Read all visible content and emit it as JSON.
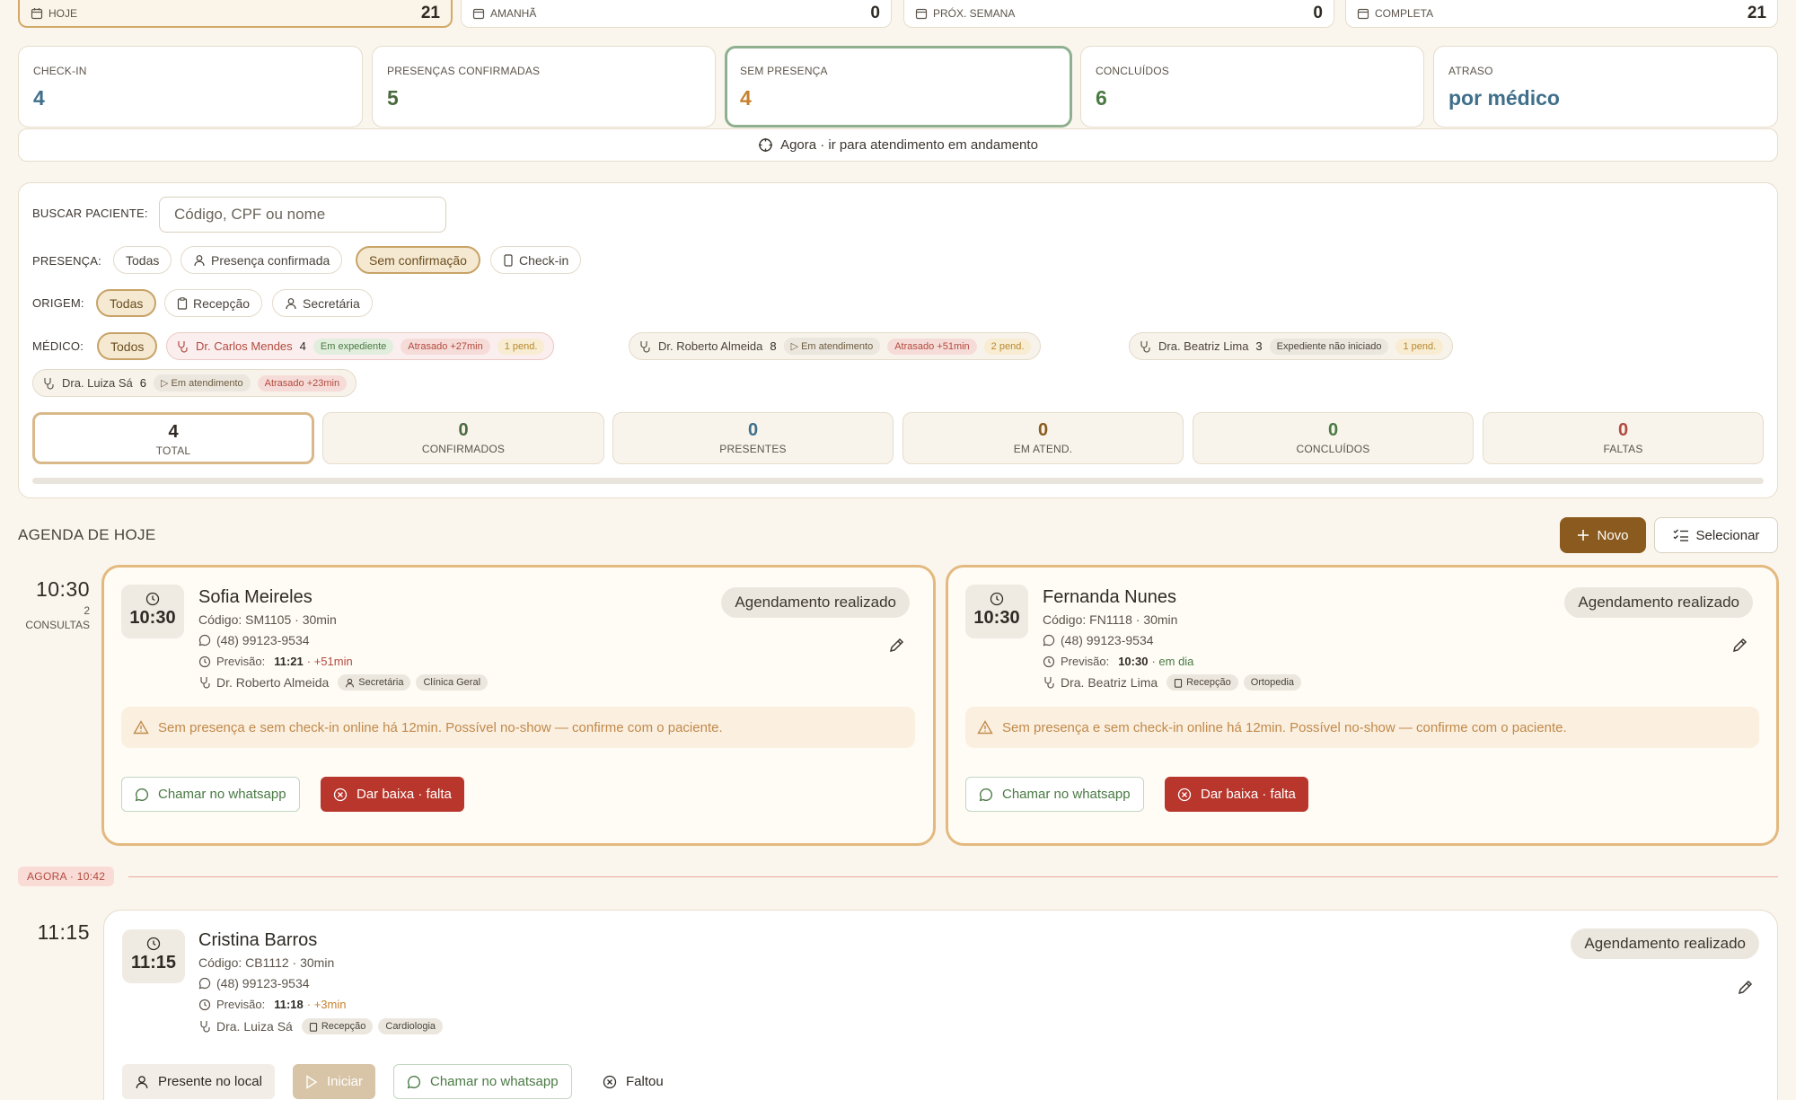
{
  "date_tabs": [
    {
      "label": "HOJE",
      "count": "21"
    },
    {
      "label": "AMANHÃ",
      "count": "0"
    },
    {
      "label": "PRÓX. SEMANA",
      "count": "0"
    },
    {
      "label": "COMPLETA",
      "count": "21"
    }
  ],
  "stats": [
    {
      "label": "CHECK-IN",
      "value": "4"
    },
    {
      "label": "PRESENÇAS CONFIRMADAS",
      "value": "5"
    },
    {
      "label": "SEM PRESENÇA",
      "value": "4"
    },
    {
      "label": "CONCLUÍDOS",
      "value": "6"
    },
    {
      "label": "ATRASO",
      "value": "por médico"
    }
  ],
  "now_link": "Agora · ir para atendimento em andamento",
  "filters": {
    "search_label": "BUSCAR PACIENTE:",
    "search_placeholder": "Código, CPF ou nome",
    "presence_label": "PRESENÇA:",
    "presence": [
      "Todas",
      "Presença confirmada",
      "Sem confirmação",
      "Check-in"
    ],
    "origin_label": "ORIGEM:",
    "origin": [
      "Todas",
      "Recepção",
      "Secretária"
    ],
    "doctor_label": "MÉDICO:",
    "doctor_all": "Todos",
    "doctors": [
      {
        "name": "Dr. Carlos Mendes",
        "count": "4",
        "status": "Em expediente",
        "delay": "Atrasado +27min",
        "pend": "1 pend."
      },
      {
        "name": "Dr. Roberto Almeida",
        "count": "8",
        "status": "Em atendimento",
        "delay": "Atrasado +51min",
        "pend": "2 pend."
      },
      {
        "name": "Dra. Beatriz Lima",
        "count": "3",
        "status": "Expediente não iniciado",
        "pend": "1 pend."
      },
      {
        "name": "Dra. Luiza Sá",
        "count": "6",
        "status": "Em atendimento",
        "delay": "Atrasado +23min"
      }
    ]
  },
  "summary": [
    {
      "n": "4",
      "l": "TOTAL"
    },
    {
      "n": "0",
      "l": "CONFIRMADOS"
    },
    {
      "n": "0",
      "l": "PRESENTES"
    },
    {
      "n": "0",
      "l": "EM ATEND."
    },
    {
      "n": "0",
      "l": "CONCLUÍDOS"
    },
    {
      "n": "0",
      "l": "FALTAS"
    }
  ],
  "agenda": {
    "title": "AGENDA DE HOJE",
    "novo": "Novo",
    "selecionar": "Selecionar",
    "slot1": {
      "time": "10:30",
      "count": "2",
      "count_label": "CONSULTAS"
    },
    "slot2": {
      "time": "11:15"
    },
    "now_tag": "AGORA · 10:42"
  },
  "appointments": [
    {
      "time": "10:30",
      "name": "Sofia Meireles",
      "code": "Código: SM1105 · 30min",
      "phone": "(48) 99123-9534",
      "forecast_label": "Previsão:",
      "forecast": "11:21",
      "forecast_delta": "· +51min",
      "doctor": "Dr. Roberto Almeida",
      "origin": "Secretária",
      "specialty": "Clínica Geral",
      "status": "Agendamento realizado",
      "warning": "Sem presença e sem check-in online há 12min. Possível no-show — confirme com o paciente.",
      "btn_whatsapp": "Chamar no whatsapp",
      "btn_falta": "Dar baixa · falta"
    },
    {
      "time": "10:30",
      "name": "Fernanda Nunes",
      "code": "Código: FN1118 · 30min",
      "phone": "(48) 99123-9534",
      "forecast_label": "Previsão:",
      "forecast": "10:30",
      "forecast_delta": "· em dia",
      "doctor": "Dra. Beatriz Lima",
      "origin": "Recepção",
      "specialty": "Ortopedia",
      "status": "Agendamento realizado",
      "warning": "Sem presença e sem check-in online há 12min. Possível no-show — confirme com o paciente.",
      "btn_whatsapp": "Chamar no whatsapp",
      "btn_falta": "Dar baixa · falta"
    },
    {
      "time": "11:15",
      "name": "Cristina Barros",
      "code": "Código: CB1112 · 30min",
      "phone": "(48) 99123-9534",
      "forecast_label": "Previsão:",
      "forecast": "11:18",
      "forecast_delta": "· +3min",
      "doctor": "Dra. Luiza Sá",
      "origin": "Recepção",
      "specialty": "Cardiologia",
      "status": "Agendamento realizado",
      "btn_presente": "Presente no local",
      "btn_iniciar": "Iniciar",
      "btn_whatsapp": "Chamar no whatsapp",
      "btn_faltou": "Faltou"
    }
  ],
  "colors": {
    "accent": "#8a5a1e",
    "checkin": "#3f6f8a",
    "confirmed": "#4a6a3e",
    "no_presence": "#c8822e",
    "done": "#4a7a44",
    "delay": "#3f6f8a"
  }
}
